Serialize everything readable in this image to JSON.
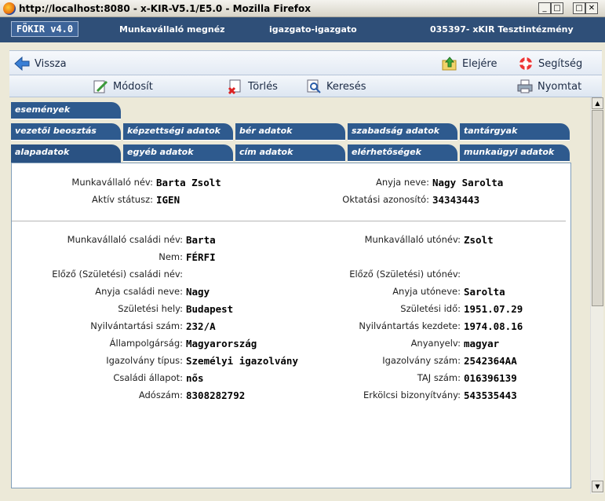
{
  "window": {
    "title": "http://localhost:8080 - x-KIR-V5.1/E5.0 - Mozilla Firefox"
  },
  "header": {
    "logo": "FÖKIR v4.0",
    "page": "Munkavállaló megnéz",
    "user": "igazgato-igazgato",
    "institution": "035397- xKIR Tesztintézmény"
  },
  "nav": {
    "back": "Vissza",
    "top": "Elejére",
    "help": "Segítség",
    "modify": "Módosít",
    "delete": "Törlés",
    "search": "Keresés",
    "print": "Nyomtat"
  },
  "tabs": {
    "row1": [
      "események"
    ],
    "row2": [
      "vezetői beosztás",
      "képzettségi adatok",
      "bér adatok",
      "szabadság adatok",
      "tantárgyak"
    ],
    "row3": [
      "alapadatok",
      "egyéb adatok",
      "cím adatok",
      "elérhetőségek",
      "munkaügyi adatok"
    ]
  },
  "summary": {
    "name_label": "Munkavállaló név:",
    "name": "Barta Zsolt",
    "status_label": "Aktív státusz:",
    "status": "IGEN",
    "mother_label": "Anyja neve:",
    "mother": "Nagy Sarolta",
    "edu_id_label": "Oktatási azonosító:",
    "edu_id": "34343443"
  },
  "details": {
    "left": [
      {
        "label": "Munkavállaló családi név:",
        "value": "Barta"
      },
      {
        "label": "Nem:",
        "value": "FÉRFI"
      },
      {
        "label": "Előző (Születési) családi név:",
        "value": ""
      },
      {
        "label": "Anyja családi neve:",
        "value": "Nagy"
      },
      {
        "label": "Születési hely:",
        "value": "Budapest"
      },
      {
        "label": "Nyilvántartási szám:",
        "value": "232/A"
      },
      {
        "label": "Állampolgárság:",
        "value": "Magyarország"
      },
      {
        "label": "Igazolvány típus:",
        "value": "Személyi igazolvány"
      },
      {
        "label": "Családi állapot:",
        "value": "nős"
      },
      {
        "label": "Adószám:",
        "value": "8308282792"
      }
    ],
    "right": [
      {
        "label": "Munkavállaló utónév:",
        "value": "Zsolt"
      },
      {
        "label": "",
        "value": ""
      },
      {
        "label": "Előző (Születési) utónév:",
        "value": ""
      },
      {
        "label": "Anyja utóneve:",
        "value": "Sarolta"
      },
      {
        "label": "Születési idő:",
        "value": "1951.07.29"
      },
      {
        "label": "Nyilvántartás kezdete:",
        "value": "1974.08.16"
      },
      {
        "label": "Anyanyelv:",
        "value": "magyar"
      },
      {
        "label": "Igazolvány szám:",
        "value": "2542364AA"
      },
      {
        "label": "TAJ szám:",
        "value": "016396139"
      },
      {
        "label": "Erkölcsi bizonyítvány:",
        "value": "543535443"
      }
    ]
  }
}
